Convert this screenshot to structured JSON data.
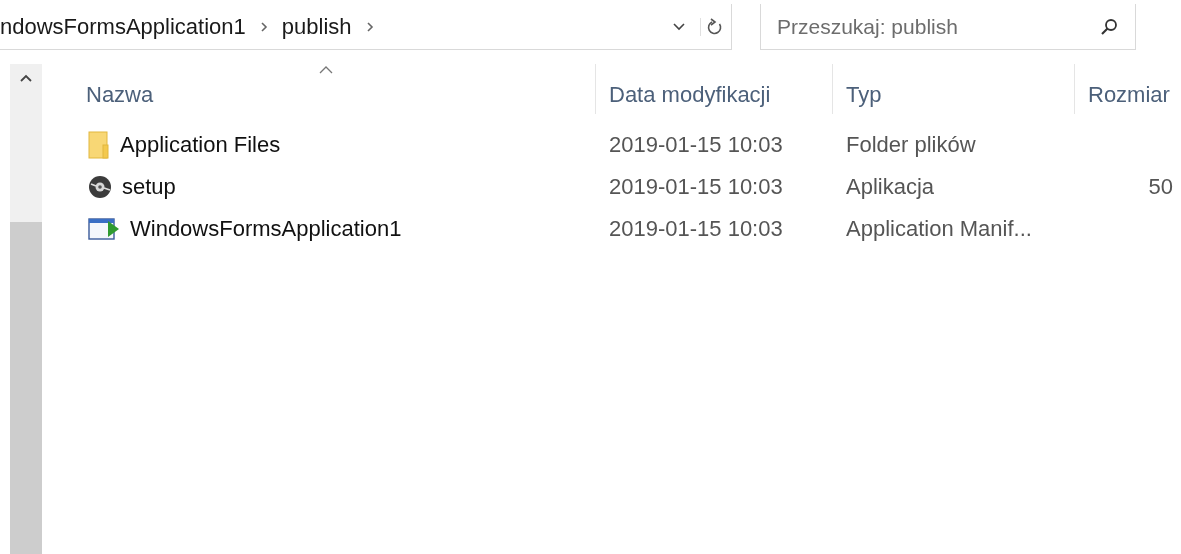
{
  "address_bar": {
    "breadcrumbs": [
      "ndowsFormsApplication1",
      "publish"
    ]
  },
  "search": {
    "placeholder": "Przeszukaj: publish"
  },
  "table": {
    "columns": [
      {
        "label": "Nazwa",
        "sorted": true
      },
      {
        "label": "Data modyfikacji",
        "sorted": false
      },
      {
        "label": "Typ",
        "sorted": false
      },
      {
        "label": "Rozmiar",
        "sorted": false
      }
    ],
    "rows": [
      {
        "kind": "folder",
        "name": "Application Files",
        "date": "2019-01-15 10:03",
        "type": "Folder plików",
        "size": ""
      },
      {
        "kind": "setup",
        "name": "setup",
        "date": "2019-01-15 10:03",
        "type": "Aplikacja",
        "size": "50"
      },
      {
        "kind": "manifest",
        "name": "WindowsFormsApplication1",
        "date": "2019-01-15 10:03",
        "type": "Application Manif...",
        "size": ""
      }
    ]
  }
}
